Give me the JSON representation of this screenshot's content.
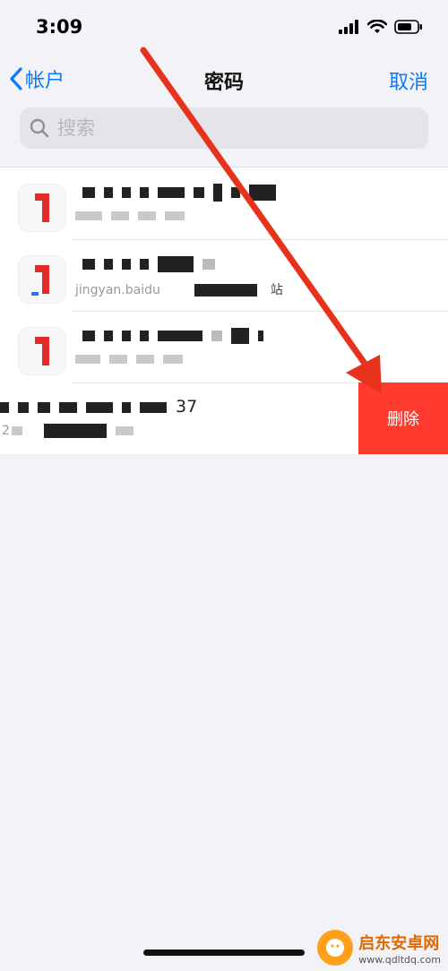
{
  "status_bar": {
    "time": "3:09"
  },
  "nav": {
    "back_label": "帐户",
    "title": "密码",
    "cancel_label": "取消"
  },
  "search": {
    "placeholder": "搜索"
  },
  "rows": [
    {
      "subtitle": ""
    },
    {
      "subtitle": "jingyan.baidu",
      "suffix": "站"
    },
    {
      "subtitle": ""
    },
    {
      "title_suffix": "37",
      "subtitle": "2"
    }
  ],
  "actions": {
    "delete_label": "删除"
  },
  "colors": {
    "accent": "#0a7aff",
    "delete": "#ff3b30",
    "annotation_arrow": "#e8331c"
  },
  "watermark": {
    "name": "启东安卓网",
    "url": "www.qdltdq.com"
  }
}
